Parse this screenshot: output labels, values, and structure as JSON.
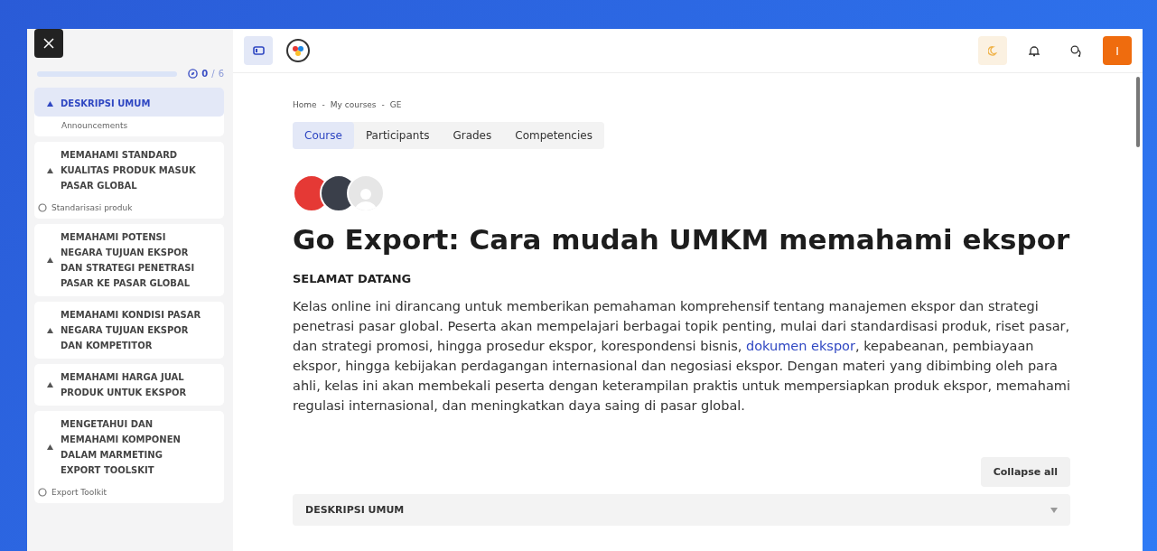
{
  "progress": {
    "level": 0,
    "done": "0",
    "separator": "/",
    "total": "6"
  },
  "sidebar": {
    "sections": [
      {
        "title": "DESKRIPSI UMUM",
        "selected": true,
        "activities": [
          {
            "kind": "label",
            "name": "Announcements"
          }
        ]
      },
      {
        "title": "MEMAHAMI STANDARD KUALITAS PRODUK MASUK PASAR GLOBAL",
        "selected": false,
        "activities": [
          {
            "kind": "todo",
            "name": "Standarisasi produk"
          }
        ]
      },
      {
        "title": "MEMAHAMI POTENSI NEGARA TUJUAN EKSPOR DAN STRATEGI PENETRASI PASAR KE PASAR GLOBAL",
        "selected": false
      },
      {
        "title": "MEMAHAMI KONDISI PASAR NEGARA TUJUAN EKSPOR DAN KOMPETITOR",
        "selected": false
      },
      {
        "title": "MEMAHAMI HARGA JUAL PRODUK UNTUK EKSPOR",
        "selected": false
      },
      {
        "title": "MENGETAHUI DAN MEMAHAMI KOMPONEN DALAM MARMETING EXPORT TOOLSKIT",
        "selected": false,
        "activities": [
          {
            "kind": "todo",
            "name": "Export Toolkit"
          }
        ]
      }
    ]
  },
  "topbar": {
    "avatar_initial": "I"
  },
  "breadcrumb": [
    "Home",
    "My courses",
    "GE"
  ],
  "breadcrumb_separator": "-",
  "tabs": [
    {
      "label": "Course",
      "selected": true
    },
    {
      "label": "Participants",
      "selected": false
    },
    {
      "label": "Grades",
      "selected": false
    },
    {
      "label": "Competencies",
      "selected": false
    }
  ],
  "course": {
    "title": "Go Export: Cara mudah UMKM memahami ekspor",
    "subtitle": "SELAMAT DATANG",
    "intro": {
      "before": "Kelas online ini dirancang untuk memberikan pemahaman komprehensif tentang manajemen ekspor dan strategi penetrasi pasar global. Peserta akan mempelajari berbagai topik penting, mulai dari standardisasi produk, riset pasar, dan strategi promosi, hingga prosedur ekspor, korespondensi bisnis, ",
      "link": "dokumen ekspor",
      "after": ", kepabeanan, pembiayaan ekspor, hingga kebijakan perdagangan internasional dan negosiasi ekspor. Dengan materi yang dibimbing oleh para ahli, kelas ini akan membekali peserta dengan keterampilan praktis untuk mempersiapkan produk ekspor, memahami regulasi internasional, dan meningkatkan daya saing di pasar global."
    }
  },
  "collapse_button": "Collapse all",
  "sections": [
    {
      "title": "DESKRIPSI UMUM",
      "expanded": false
    }
  ]
}
